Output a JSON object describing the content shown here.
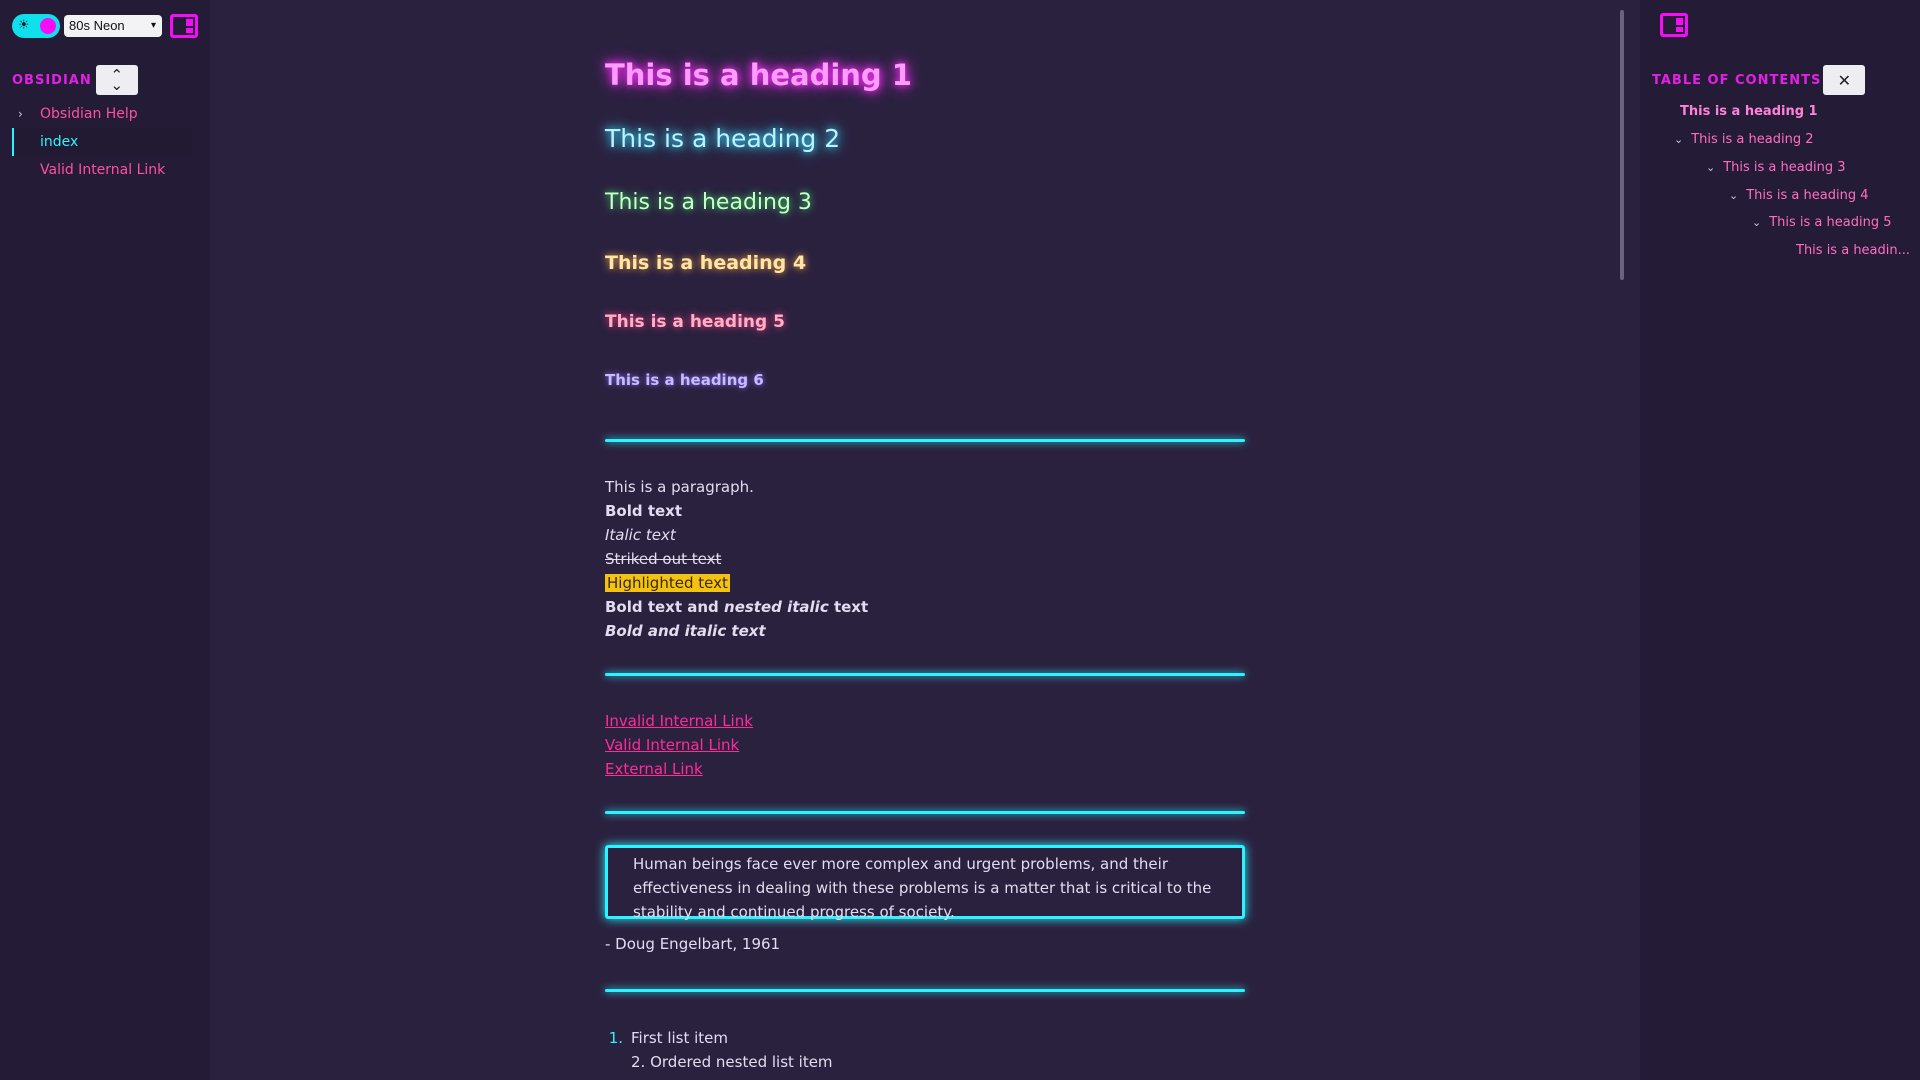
{
  "theme": {
    "selected": "80s Neon",
    "accent_pink": "#f70cf7",
    "accent_cyan": "#2cf3ff",
    "link_color": "#ff2c99",
    "highlight_color": "#f4c213"
  },
  "left_sidebar": {
    "vault_title": "OBSIDIAN",
    "sort_icon": "sort-icon",
    "files": [
      {
        "label": "Obsidian Help",
        "type": "folder"
      },
      {
        "label": "index",
        "type": "file",
        "active": true
      },
      {
        "label": "Valid Internal Link",
        "type": "file"
      }
    ]
  },
  "document": {
    "headings": [
      "This is a heading 1",
      "This is a heading 2",
      "This is a heading 3",
      "This is a heading 4",
      "This is a heading 5",
      "This is a heading 6"
    ],
    "paragraph": "This is a paragraph.",
    "bold": "Bold text",
    "italic": "Italic text",
    "strike": "Striked out text",
    "highlight": "Highlighted text",
    "mixed_bold_1": "Bold text and ",
    "mixed_italic": "nested italic",
    "mixed_bold_2": " text",
    "bold_italic": "Bold and italic text",
    "links": [
      "Invalid Internal Link",
      "Valid Internal Link",
      "External Link"
    ],
    "blockquote": "Human beings face ever more complex and urgent problems, and their effectiveness in dealing with these problems is a matter that is critical to the stability and continued progress of society.",
    "citation": "- Doug Engelbart, 1961",
    "list": [
      {
        "number": "1.",
        "text": "First list item"
      },
      {
        "number": "2.",
        "text": "Ordered nested list item"
      }
    ]
  },
  "right_sidebar": {
    "toc_title": "TABLE OF CONTENTS",
    "toc_items": [
      "This is a heading 1",
      "This is a heading 2",
      "This is a heading 3",
      "This is a heading 4",
      "This is a heading 5",
      "This is a headin..."
    ]
  }
}
